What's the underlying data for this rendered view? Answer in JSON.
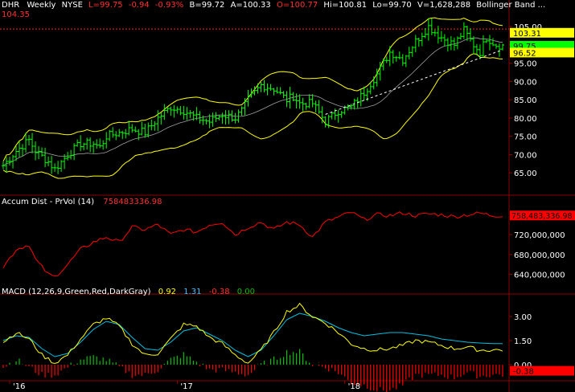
{
  "header": {
    "symbol": "DHR",
    "interval": "Weekly",
    "exchange": "NYSE",
    "last": "L=99.75",
    "change": "-0.94",
    "change_pct": "-0.93%",
    "bid": "B=99.72",
    "ask": "A=100.33",
    "open": "O=100.77",
    "high": "Hi=100.81",
    "low": "Lo=99.70",
    "volume": "V=1,628,288",
    "study": "Bollinger Band ..."
  },
  "colors": {
    "background": "#000000",
    "price_bar": "#00ff00",
    "bollinger": "#ffff00",
    "moving_avg": "#a0a0a0",
    "accum": "#ff0000",
    "macd_line": "#ffff00",
    "signal_line": "#00c0e0",
    "hist_pos": "#00c000",
    "hist_neg": "#ff0000",
    "grid": "#8b0000",
    "axis_text": "#ffffff"
  },
  "price_panel": {
    "ref_level_label": "104.35",
    "ref_level": 104.35,
    "upper_band_label": "103.31",
    "last_label": "99.75",
    "lower_band_label": "96.52",
    "y_ticks": [
      "105.00",
      "100.00",
      "95.00",
      "90.00",
      "85.00",
      "80.00",
      "75.00",
      "70.00",
      "65.00"
    ],
    "y_tick_values": [
      105,
      100,
      95,
      90,
      85,
      80,
      75,
      70,
      65
    ],
    "ylim": [
      60,
      107
    ]
  },
  "accum_panel": {
    "title": "Accum Dist - PrVol (14)",
    "value": "758483336.98",
    "value_label": "758,483,336.98",
    "y_ticks": [
      "720,000,000",
      "680,000,000",
      "640,000,000"
    ],
    "y_tick_values": [
      720000000,
      680000000,
      640000000
    ],
    "ylim": [
      620000000,
      775000000
    ]
  },
  "macd_panel": {
    "title": "MACD (12,26,9,Green,Red,DarkGray)",
    "macd": "0.92",
    "signal": "1.31",
    "hist": "-0.38",
    "zero": "0.00",
    "y_ticks": [
      "3.00",
      "1.50",
      "0.00"
    ],
    "y_tick_values": [
      3,
      1.5,
      0
    ],
    "hist_label": "-0.38",
    "ylim": [
      -0.8,
      4.2
    ]
  },
  "x_axis": {
    "labels": [
      "'16",
      "'17",
      "'18"
    ],
    "label_weeks": [
      2,
      54,
      106
    ]
  },
  "chart_data": [
    {
      "type": "ohlc",
      "title": "DHR Weekly NYSE",
      "series": [
        {
          "name": "Bollinger Band",
          "values": []
        }
      ],
      "anchors_week": [
        0,
        4,
        8,
        10,
        14,
        16,
        20,
        24,
        28,
        30,
        32,
        36,
        40,
        44,
        48,
        52,
        56,
        60,
        64,
        68,
        72,
        74,
        76,
        80,
        84,
        88,
        90,
        92,
        96,
        100,
        104,
        108,
        112,
        116,
        120,
        124,
        128,
        132,
        136,
        140,
        143,
        146,
        148,
        150,
        153,
        155
      ],
      "anchors_close": [
        67,
        71,
        74,
        71,
        68,
        66,
        70,
        73,
        73,
        72,
        75,
        76,
        77,
        76,
        80,
        83,
        82,
        80,
        79,
        81,
        80,
        82,
        85,
        89,
        88,
        85,
        86,
        84,
        84,
        79,
        82,
        83,
        87,
        92,
        98,
        96,
        101,
        105,
        102,
        100,
        104,
        100,
        98,
        102,
        100,
        99.75
      ],
      "ylim": [
        60,
        107
      ]
    },
    {
      "type": "line",
      "title": "Accum Dist - PrVol (14)",
      "anchors_week": [
        0,
        4,
        8,
        10,
        14,
        16,
        20,
        24,
        28,
        32,
        36,
        40,
        44,
        48,
        52,
        56,
        60,
        64,
        68,
        72,
        76,
        80,
        84,
        88,
        92,
        96,
        100,
        104,
        108,
        112,
        116,
        120,
        124,
        128,
        132,
        136,
        140,
        144,
        148,
        152,
        155
      ],
      "anchors_value": [
        655,
        690,
        700,
        670,
        640,
        635,
        660,
        690,
        705,
        715,
        705,
        735,
        730,
        740,
        720,
        730,
        725,
        740,
        745,
        720,
        735,
        745,
        730,
        745,
        740,
        715,
        745,
        755,
        765,
        750,
        760,
        758,
        764,
        758,
        762,
        760,
        756,
        760,
        763,
        758,
        758.48
      ],
      "value_unit": "millions",
      "ylim": [
        620,
        775
      ]
    },
    {
      "type": "line",
      "title": "MACD (12,26,9,Green,Red,DarkGray)",
      "series": [
        {
          "name": "MACD",
          "anchors_week": [
            0,
            4,
            8,
            12,
            16,
            20,
            24,
            28,
            32,
            36,
            40,
            44,
            48,
            52,
            56,
            60,
            64,
            68,
            72,
            76,
            80,
            84,
            88,
            92,
            96,
            100,
            104,
            108,
            112,
            116,
            120,
            124,
            128,
            132,
            136,
            140,
            144,
            148,
            152,
            155
          ],
          "anchors_value": [
            1.4,
            2.0,
            1.6,
            0.6,
            0.1,
            0.6,
            1.6,
            2.5,
            2.9,
            2.4,
            1.3,
            0.6,
            0.7,
            1.6,
            2.5,
            2.4,
            1.7,
            1.3,
            0.6,
            0.1,
            0.9,
            2.0,
            3.3,
            3.7,
            3.0,
            2.6,
            2.0,
            1.3,
            1.0,
            0.92,
            1.0,
            1.2,
            1.5,
            1.4,
            1.2,
            1.0,
            1.1,
            0.9,
            0.92,
            0.92
          ]
        },
        {
          "name": "Signal",
          "anchors_week": [
            0,
            4,
            8,
            12,
            16,
            20,
            24,
            28,
            32,
            36,
            40,
            44,
            48,
            52,
            56,
            60,
            64,
            68,
            72,
            76,
            80,
            84,
            88,
            92,
            96,
            100,
            104,
            108,
            112,
            116,
            120,
            124,
            128,
            132,
            136,
            140,
            144,
            148,
            152,
            155
          ],
          "anchors_value": [
            1.5,
            1.8,
            1.7,
            1.0,
            0.5,
            0.7,
            1.4,
            2.2,
            2.7,
            2.5,
            1.7,
            1.0,
            0.9,
            1.4,
            2.1,
            2.3,
            1.9,
            1.5,
            0.9,
            0.5,
            0.9,
            1.8,
            2.8,
            3.2,
            3.0,
            2.7,
            2.3,
            2.0,
            1.8,
            1.9,
            2.0,
            2.0,
            1.9,
            1.8,
            1.6,
            1.5,
            1.4,
            1.35,
            1.31,
            1.31
          ]
        }
      ],
      "ylim": [
        -0.8,
        4.2
      ]
    }
  ]
}
